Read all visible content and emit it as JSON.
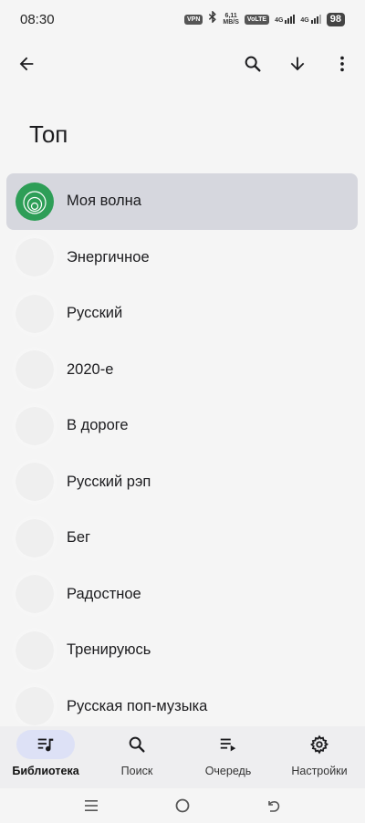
{
  "status_bar": {
    "time": "08:30",
    "vpn": "VPN",
    "speed_value": "6,11",
    "speed_unit": "MB/S",
    "volte": "VoLTE",
    "sim1_label": "4G",
    "sim2_label": "4G",
    "battery": "98"
  },
  "top_bar": {
    "back_icon": "arrow-left-icon",
    "search_icon": "search-icon",
    "download_icon": "arrow-down-icon",
    "more_icon": "more-vert-icon"
  },
  "page": {
    "title": "Топ"
  },
  "list": {
    "items": [
      {
        "label": "Моя волна",
        "active": true,
        "thumb": "wave-logo"
      },
      {
        "label": "Энергичное"
      },
      {
        "label": "Русский"
      },
      {
        "label": "2020-е"
      },
      {
        "label": "В дороге"
      },
      {
        "label": "Русский рэп"
      },
      {
        "label": "Бег"
      },
      {
        "label": "Радостное"
      },
      {
        "label": "Тренируюсь"
      },
      {
        "label": "Русская поп-музыка"
      }
    ]
  },
  "bottom_nav": {
    "items": [
      {
        "label": "Библиотека",
        "icon": "library-music-icon",
        "active": true
      },
      {
        "label": "Поиск",
        "icon": "search-icon"
      },
      {
        "label": "Очередь",
        "icon": "queue-icon"
      },
      {
        "label": "Настройки",
        "icon": "settings-icon"
      }
    ]
  },
  "colors": {
    "background": "#f5f5f5",
    "active_item": "#d6d7de",
    "wave_green": "#2e9e57",
    "nav_background": "#eeeef0",
    "nav_active_pill": "#dde1f6"
  }
}
